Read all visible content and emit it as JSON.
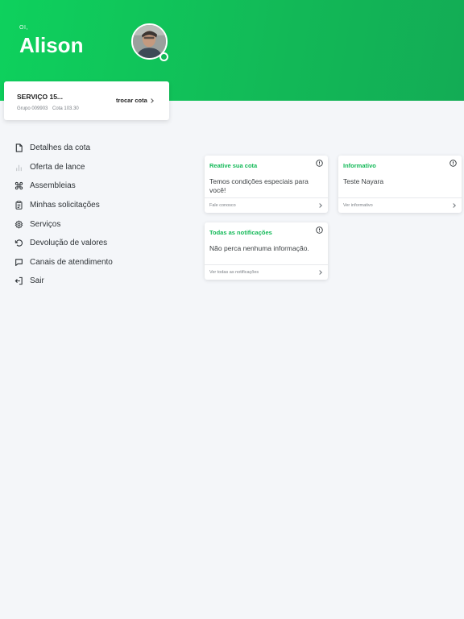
{
  "header": {
    "greeting": "OI,",
    "username": "Alison",
    "brand_color": "#12b957"
  },
  "quota": {
    "title": "SERVIÇO 15...",
    "group": "Grupo 009903",
    "quota": "Cota 103.30",
    "switch_label": "trocar cota"
  },
  "menu": {
    "items": [
      {
        "label": "Detalhes da cota",
        "icon": "document-icon"
      },
      {
        "label": "Oferta de lance",
        "icon": "bar-chart-icon"
      },
      {
        "label": "Assembleias",
        "icon": "command-icon"
      },
      {
        "label": "Minhas solicitações",
        "icon": "clipboard-icon"
      },
      {
        "label": "Serviços",
        "icon": "gear-icon"
      },
      {
        "label": "Devolução de valores",
        "icon": "undo-icon"
      },
      {
        "label": "Canais de atendimento",
        "icon": "chat-icon"
      },
      {
        "label": "Sair",
        "icon": "logout-icon"
      }
    ]
  },
  "cards": {
    "reactivate": {
      "title": "Reative sua cota",
      "body": "Temos condições especiais para você!",
      "footer": "Fale conosco"
    },
    "informative": {
      "title": "Informativo",
      "body": "Teste Nayara",
      "footer": "Ver informativo"
    },
    "notifications": {
      "title": "Todas as notificações",
      "body": "Não perca nenhuma informação.",
      "footer": "Ver todas as notificações"
    }
  }
}
